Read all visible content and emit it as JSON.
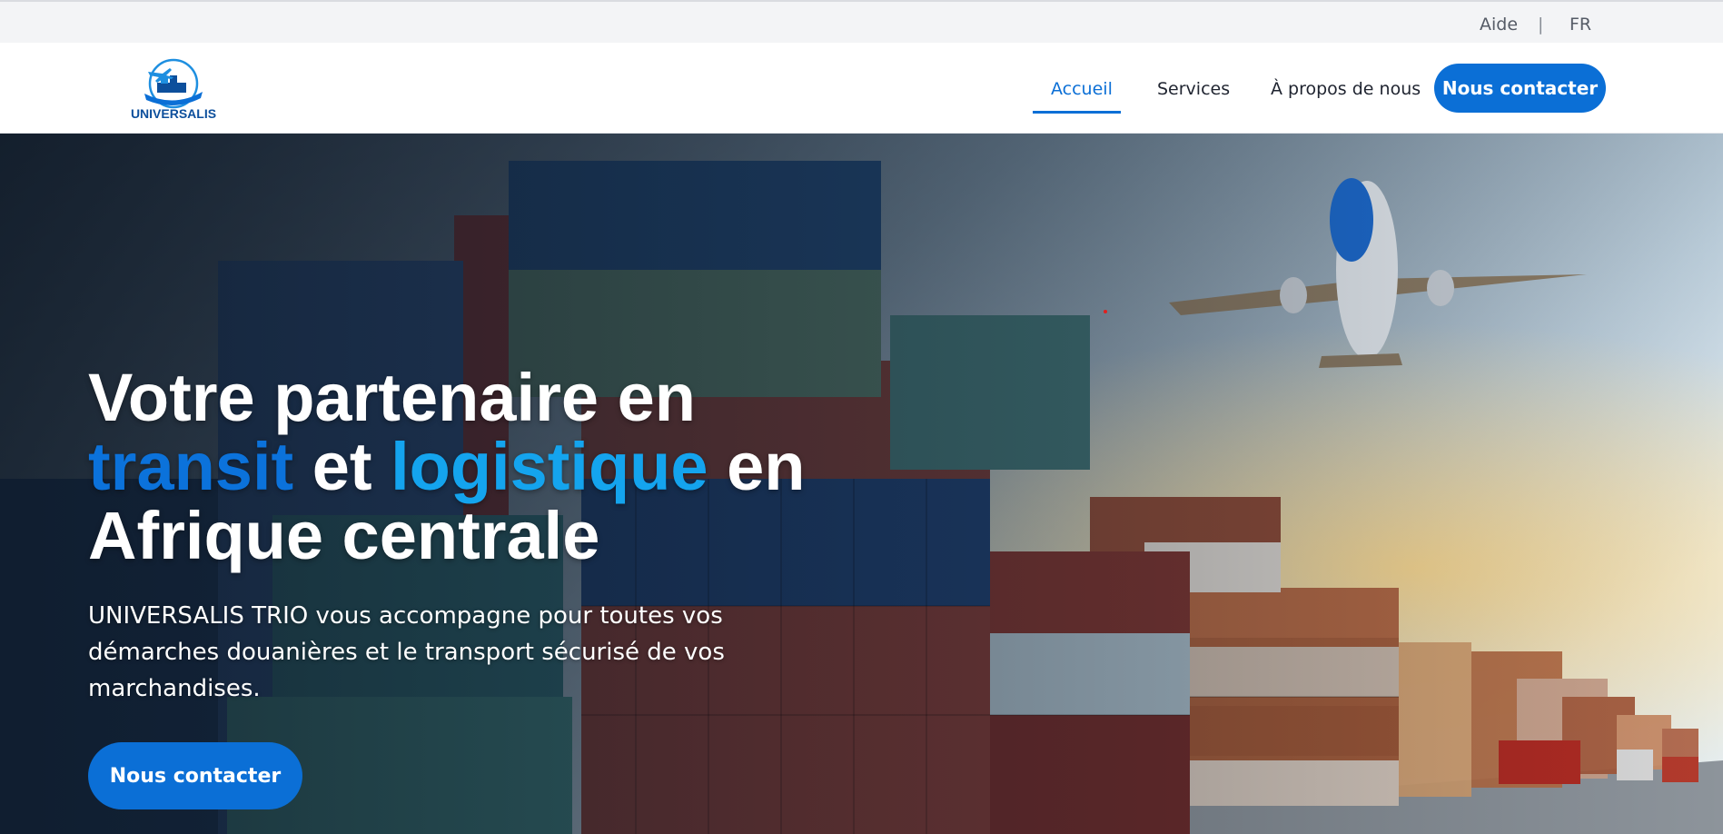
{
  "topbar": {
    "help_label": "Aide",
    "separator": "|",
    "language": "FR"
  },
  "header": {
    "logo_text": "UNIVERSALIS",
    "nav": {
      "home": "Accueil",
      "services": "Services",
      "about": "À propos de nous"
    },
    "contact_button": "Nous contacter"
  },
  "hero": {
    "title_part1": "Votre partenaire en",
    "title_highlight1": "transit",
    "title_connector": " et ",
    "title_highlight2": "logistique",
    "title_part2": " en",
    "title_part3": "Afrique centrale",
    "subtitle": "UNIVERSALIS TRIO vous accompagne pour toutes vos démarches douanières et le transport sécurisé de vos marchandises.",
    "contact_button": "Nous contacter"
  },
  "colors": {
    "brand_blue": "#0b6fd6",
    "highlight_blue": "#0b72db",
    "highlight_cyan": "#14a4ee",
    "topbar_bg": "#f3f4f6"
  },
  "icons": {
    "logo": "logo-ship-plane-icon",
    "hero_image": "containers-and-airplane-photo"
  }
}
